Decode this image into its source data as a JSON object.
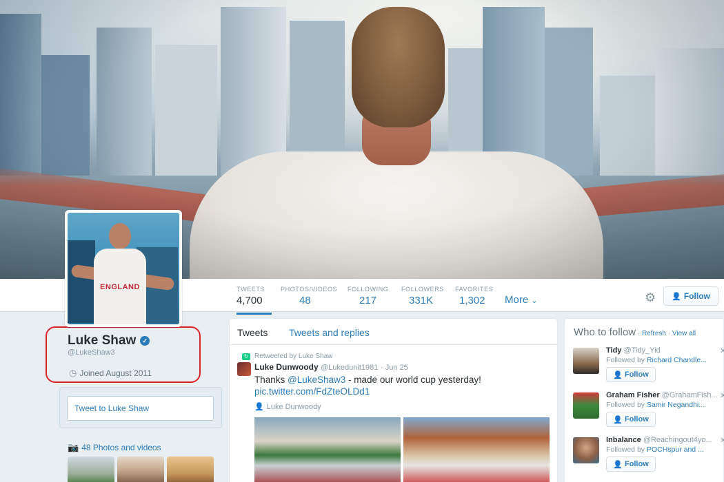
{
  "profile": {
    "name": "Luke Shaw",
    "handle": "@LukeShaw3",
    "joined": "Joined August 2011",
    "tweet_to": "Tweet to Luke Shaw",
    "photos_link": "48 Photos and videos",
    "avatar_shirt_text": "ENGLAND"
  },
  "stats": [
    {
      "label": "TWEETS",
      "value": "4,700"
    },
    {
      "label": "PHOTOS/VIDEOS",
      "value": "48"
    },
    {
      "label": "FOLLOWING",
      "value": "217"
    },
    {
      "label": "FOLLOWERS",
      "value": "331K"
    },
    {
      "label": "FAVORITES",
      "value": "1,302"
    }
  ],
  "nav": {
    "more": "More",
    "follow": "Follow"
  },
  "timeline": {
    "tabs": [
      "Tweets",
      "Tweets and replies"
    ],
    "tweet": {
      "retweeted_by": "Retweeted by Luke Shaw",
      "author": "Luke Dunwoody",
      "author_handle": "@Lukedunit1981",
      "date": "Jun 25",
      "text_prefix": "Thanks ",
      "mention": "@LukeShaw3",
      "text_suffix": " - made our world cup yesterday!",
      "link": "pic.twitter.com/FdZteOLDd1",
      "geo": "Luke Dunwoody"
    }
  },
  "who_to_follow": {
    "title": "Who to follow",
    "refresh": "Refresh",
    "view_all": "View all",
    "follow_label": "Follow",
    "users": [
      {
        "name": "Tidy",
        "handle": "@Tidy_Yid",
        "followed_by_prefix": "Followed by ",
        "followed_by": "Richard Chandle..."
      },
      {
        "name": "Graham Fisher",
        "handle": "@GrahamFish...",
        "followed_by_prefix": "Followed by ",
        "followed_by": "Samir Negandhi..."
      },
      {
        "name": "Inbalance",
        "handle": "@Reachingout4yo...",
        "followed_by_prefix": "Followed by ",
        "followed_by": "POCHspur and ..."
      }
    ]
  },
  "colors": {
    "accent": "#2b7bb9",
    "highlight_outline": "#d8232a",
    "retweet": "#19cf86"
  },
  "icons": [
    "gear-icon",
    "add-person-icon",
    "verified-icon",
    "clock-icon",
    "camera-icon",
    "retweet-icon",
    "location-icon",
    "close-icon",
    "chevron-down-icon"
  ]
}
